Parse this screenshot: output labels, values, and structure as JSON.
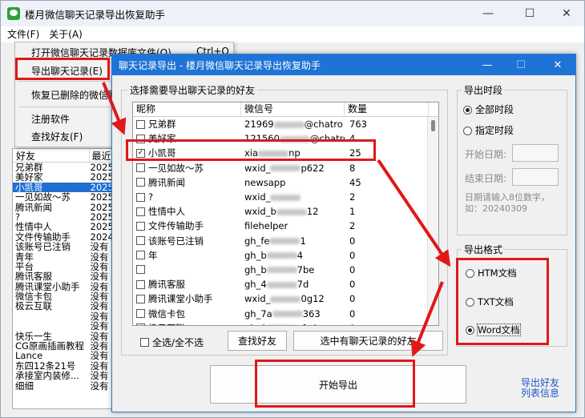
{
  "main_window": {
    "title": "楼月微信聊天记录导出恢复助手",
    "menu": [
      "文件(F)",
      "关于(A)"
    ]
  },
  "file_menu": {
    "items": [
      "打开微信聊天记录数据库文件(O)",
      "导出聊天记录(E)",
      "恢复已删除的微信聊",
      "注册软件",
      "查找好友(F)"
    ],
    "shortcut": "Ctrl+O"
  },
  "left_list": {
    "headers": [
      "好友",
      "最近"
    ],
    "rows": [
      {
        "name": "兄弟群",
        "date": "2025"
      },
      {
        "name": "美好家",
        "date": "2025"
      },
      {
        "name": "小凯哥",
        "date": "2025"
      },
      {
        "name": "一见如故～苏",
        "date": "2025"
      },
      {
        "name": "腾讯新闻",
        "date": "2025"
      },
      {
        "name": "?",
        "date": "2025"
      },
      {
        "name": "性情中人",
        "date": "2025"
      },
      {
        "name": "文件传输助手",
        "date": "2024"
      },
      {
        "name": "该账号已注销",
        "date": "没有"
      },
      {
        "name": "青年",
        "date": "没有"
      },
      {
        "name": "平台",
        "date": "没有"
      },
      {
        "name": "腾讯客服",
        "date": "没有"
      },
      {
        "name": "腾讯课堂小助手",
        "date": "没有"
      },
      {
        "name": "微信卡包",
        "date": "没有"
      },
      {
        "name": "极云互联",
        "date": "没有"
      },
      {
        "name": "",
        "date": "没有"
      },
      {
        "name": "",
        "date": "没有"
      },
      {
        "name": "快乐一生",
        "date": "没有"
      },
      {
        "name": "CG原画插画教程",
        "date": "没有"
      },
      {
        "name": "Lance",
        "date": "没有"
      },
      {
        "name": "东四12条21号",
        "date": "没有"
      },
      {
        "name": "承接室内装修...",
        "date": "没有"
      },
      {
        "name": "细细",
        "date": "没有"
      }
    ]
  },
  "dialog": {
    "title": "聊天记录导出 - 楼月微信聊天记录导出恢复助手",
    "friends_group_label": "选择需要导出聊天记录的好友",
    "columns": [
      "昵称",
      "微信号",
      "数量"
    ],
    "rows": [
      {
        "nick": "兄弟群",
        "wxid": "21969",
        "wxid_tail": "@chatro",
        "count": "763",
        "checked": false
      },
      {
        "nick": "美好家",
        "wxid": "121560",
        "wxid_tail": "@chatro",
        "count": "4",
        "checked": false
      },
      {
        "nick": "小凯哥",
        "wxid": "xia",
        "wxid_tail": "np",
        "count": "25",
        "checked": true
      },
      {
        "nick": "一见如故～苏",
        "wxid": "wxid_",
        "wxid_tail": "p622",
        "count": "8",
        "checked": false
      },
      {
        "nick": "腾讯新闻",
        "wxid": "newsapp",
        "wxid_tail": "",
        "count": "45",
        "checked": false
      },
      {
        "nick": "?",
        "wxid": "wxid_",
        "wxid_tail": "",
        "count": "2",
        "checked": false
      },
      {
        "nick": "性情中人",
        "wxid": "wxid_b",
        "wxid_tail": "12",
        "count": "1",
        "checked": false
      },
      {
        "nick": "文件传输助手",
        "wxid": "filehelper",
        "wxid_tail": "",
        "count": "2",
        "checked": false
      },
      {
        "nick": "该账号已注销",
        "wxid": "gh_fe",
        "wxid_tail": "1",
        "count": "0",
        "checked": false
      },
      {
        "nick": "年",
        "wxid": "gh_b",
        "wxid_tail": "4",
        "count": "0",
        "checked": false
      },
      {
        "nick": "",
        "wxid": "gh_b",
        "wxid_tail": "7be",
        "count": "0",
        "checked": false
      },
      {
        "nick": "腾讯客服",
        "wxid": "gh_4",
        "wxid_tail": "7d",
        "count": "0",
        "checked": false
      },
      {
        "nick": "腾讯课堂小助手",
        "wxid": "wxid_",
        "wxid_tail": "0g12",
        "count": "0",
        "checked": false
      },
      {
        "nick": "微信卡包",
        "wxid": "gh_7a",
        "wxid_tail": "363",
        "count": "0",
        "checked": false
      },
      {
        "nick": "极云互联",
        "wxid": "gh_8",
        "wxid_tail": "cfcd",
        "count": "0",
        "checked": false
      }
    ],
    "select_all_label": "全选/全不选",
    "find_friend_btn": "查找好友",
    "select_with_records_btn": "选中有聊天记录的好友",
    "period_group_label": "导出时段",
    "period_all": "全部时段",
    "period_custom": "指定时段",
    "start_label": "开始日期:",
    "end_label": "结束日期:",
    "date_hint": "日期请输入8位数字，如：20240309",
    "format_group_label": "导出格式",
    "formats": [
      "HTM文档",
      "TXT文档",
      "Word文档"
    ],
    "selected_format": "Word文档",
    "start_export_btn": "开始导出",
    "export_friend_info_link": "导出好友\n列表信息"
  },
  "colors": {
    "accent": "#1e73d6",
    "annotation": "#e01818",
    "selection": "#1e6fd0"
  }
}
